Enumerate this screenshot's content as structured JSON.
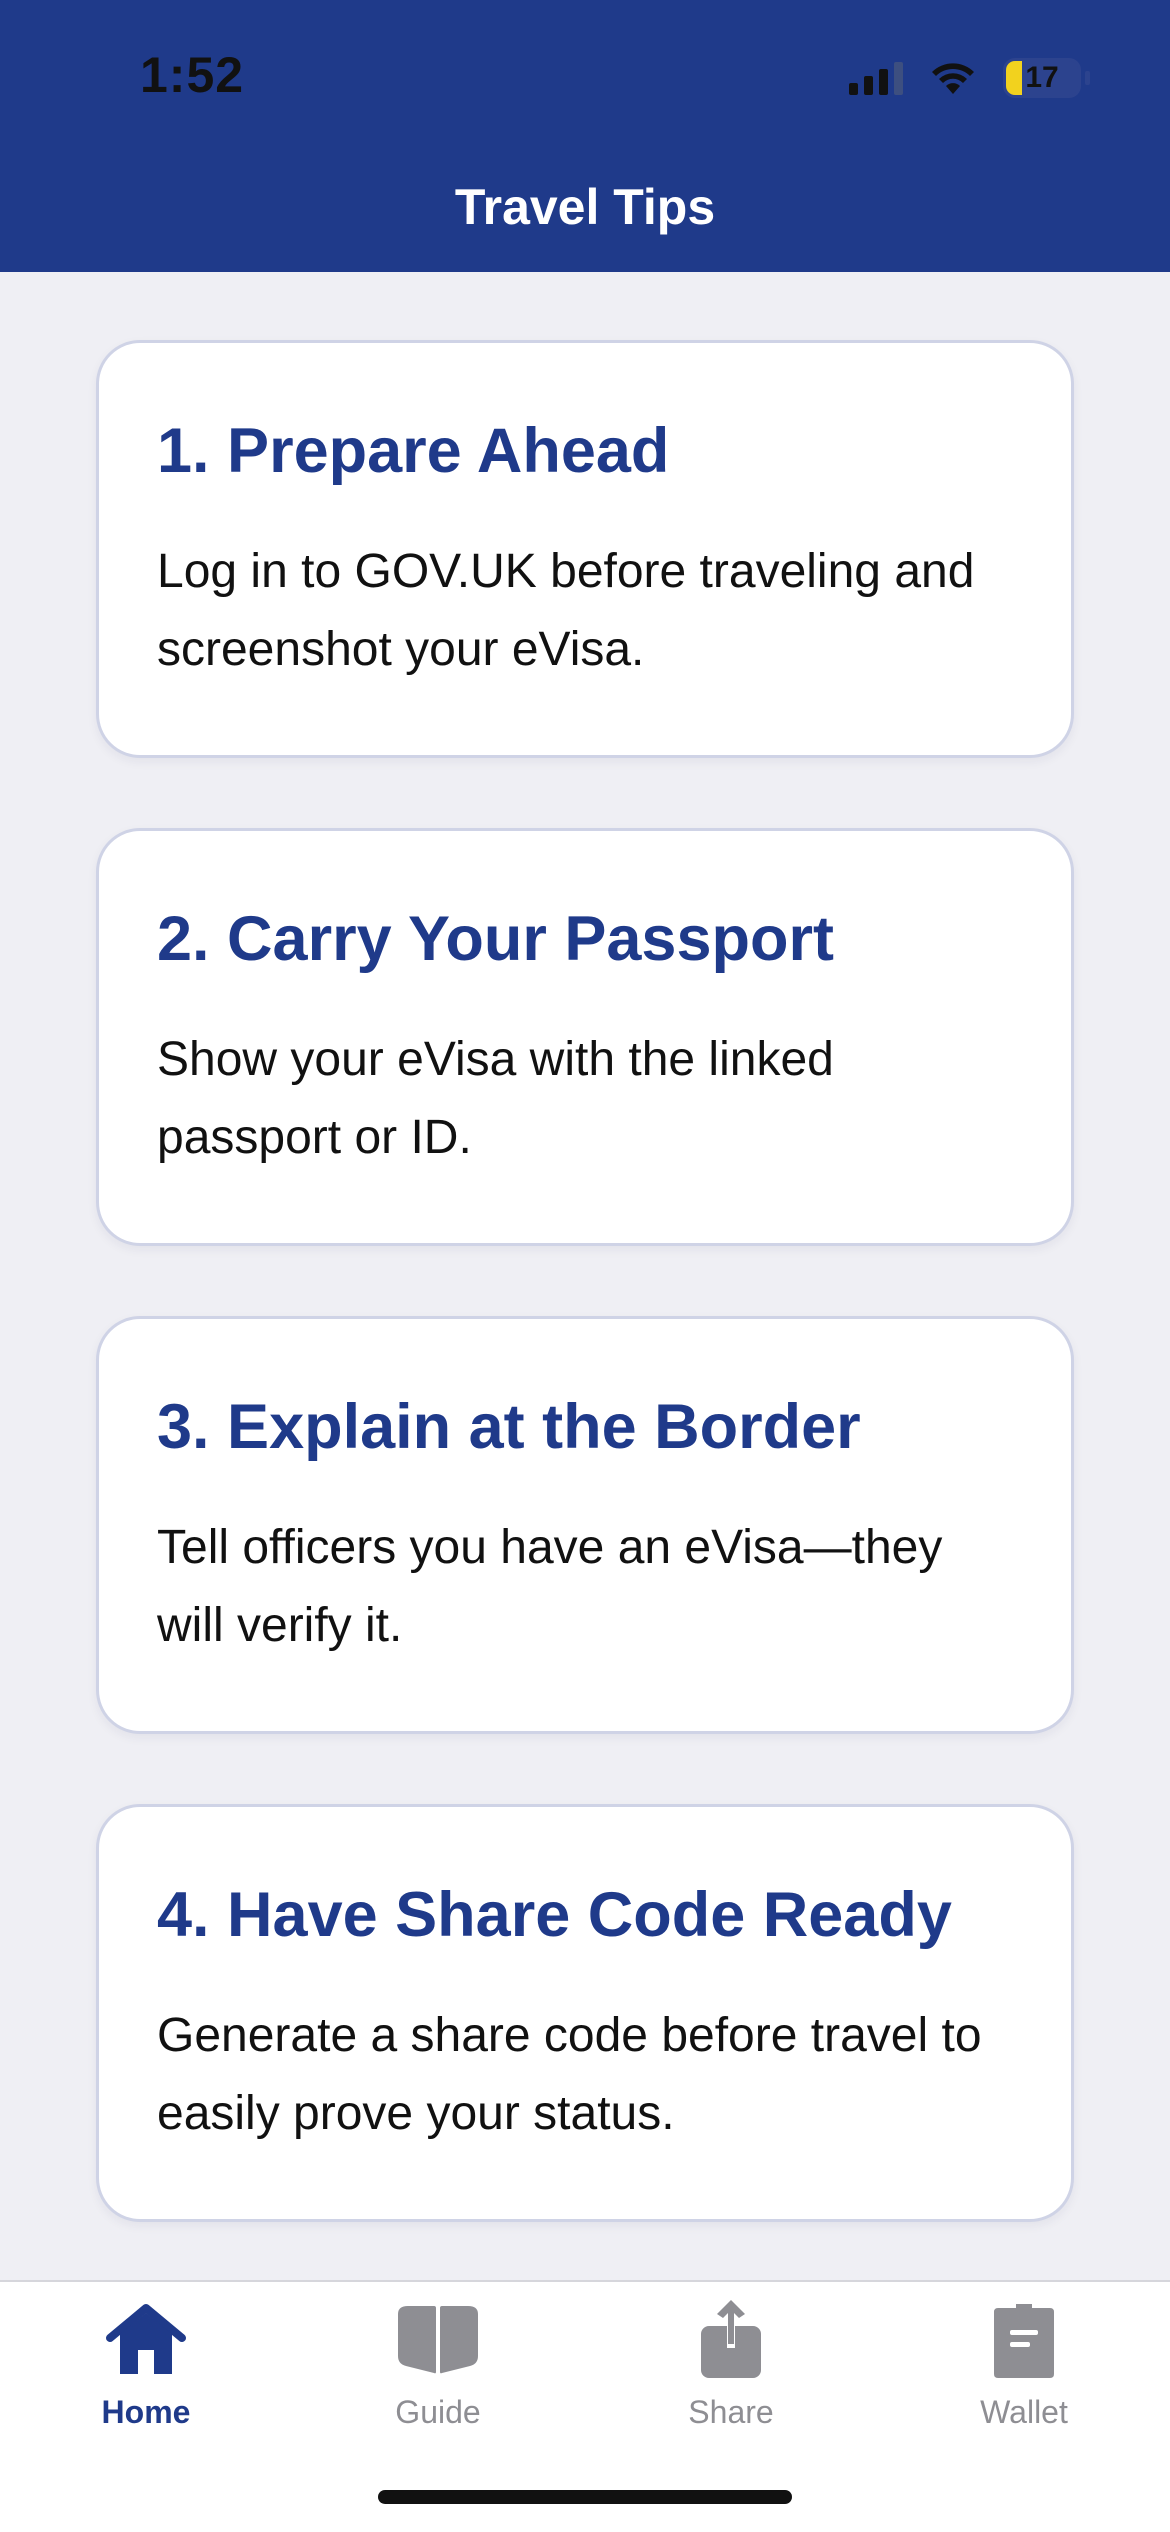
{
  "status_bar": {
    "time": "1:52",
    "battery_level": "17"
  },
  "header": {
    "title": "Travel Tips"
  },
  "cards": [
    {
      "title": "1. Prepare Ahead",
      "body": "Log in to GOV.UK before traveling and screenshot your eVisa."
    },
    {
      "title": "2. Carry Your Passport",
      "body": "Show your eVisa with the linked passport or ID."
    },
    {
      "title": "3. Explain at the Border",
      "body": "Tell officers you have an eVisa—they will verify it."
    },
    {
      "title": "4. Have Share Code Ready",
      "body": "Generate a share code before travel to easily prove your status."
    }
  ],
  "tabbar": {
    "tabs": [
      {
        "label": "Home",
        "icon": "home-icon",
        "active": true
      },
      {
        "label": "Guide",
        "icon": "book-icon",
        "active": false
      },
      {
        "label": "Share",
        "icon": "share-icon",
        "active": false
      },
      {
        "label": "Wallet",
        "icon": "wallet-icon",
        "active": false
      }
    ]
  },
  "colors": {
    "primary": "#1f3a8a",
    "background": "#efeff4",
    "inactive": "#8e8e93",
    "battery": "#f2d21e"
  }
}
